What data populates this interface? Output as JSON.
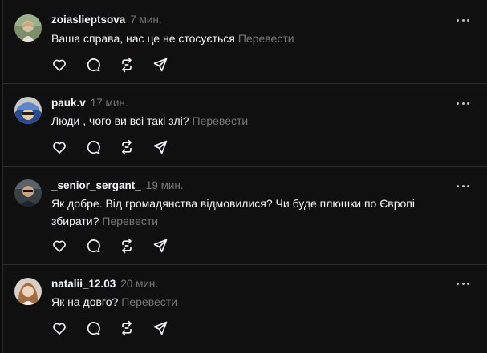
{
  "translate_label": "Перевести",
  "colors": {
    "background": "#101010",
    "text": "#f3f5f7",
    "secondary": "#777777",
    "separator": "#2d2d2d"
  },
  "icons": [
    "avatar",
    "more-options-icon",
    "like-heart-icon",
    "reply-bubble-icon",
    "repost-icon",
    "share-send-icon"
  ],
  "comments": [
    {
      "username": "zoiaslieptsova",
      "time": "7 мин.",
      "text": "Ваша справа, нас це не стосується"
    },
    {
      "username": "pauk.v",
      "time": "17 мин.",
      "text": "Люди , чого ви всі такі злі?"
    },
    {
      "username": "_senior_sergant_",
      "time": "19 мин.",
      "text": "Як добре. Від громадянства відмовилися? Чи буде плюшки по Європі збирати?"
    },
    {
      "username": "natalii_12.03",
      "time": "20 мин.",
      "text": "Як на довго?"
    }
  ]
}
